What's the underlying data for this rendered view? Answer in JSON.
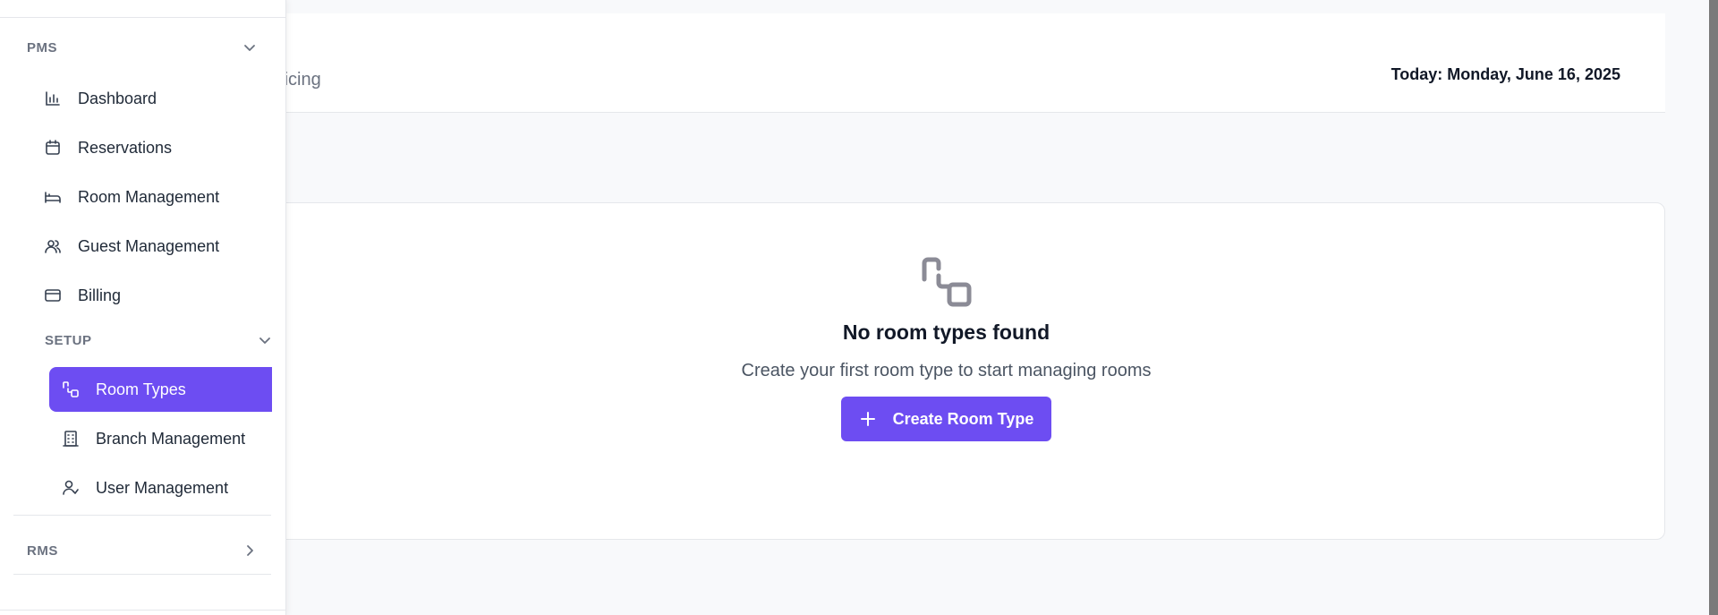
{
  "header": {
    "subtitle": "nd pricing",
    "date": "Today: Monday, June 16, 2025"
  },
  "empty_state": {
    "icon": "room-types-icon",
    "title": "No room types found",
    "description": "Create your first room type to start managing rooms",
    "button_label": "Create Room Type"
  },
  "sidebar": {
    "pms": {
      "label": "PMS",
      "items": [
        {
          "label": "Dashboard",
          "icon": "bar-chart-icon"
        },
        {
          "label": "Reservations",
          "icon": "calendar-icon"
        },
        {
          "label": "Room Management",
          "icon": "bed-icon"
        },
        {
          "label": "Guest Management",
          "icon": "users-icon"
        },
        {
          "label": "Billing",
          "icon": "credit-card-icon"
        }
      ]
    },
    "setup": {
      "label": "SETUP",
      "items": [
        {
          "label": "Room Types",
          "icon": "room-types-icon",
          "active": true
        },
        {
          "label": "Branch Management",
          "icon": "building-icon"
        },
        {
          "label": "User Management",
          "icon": "user-check-icon"
        }
      ]
    },
    "rms": {
      "label": "RMS"
    }
  },
  "colors": {
    "accent": "#6d4df2",
    "text": "#1f2937",
    "muted": "#6b7280"
  }
}
